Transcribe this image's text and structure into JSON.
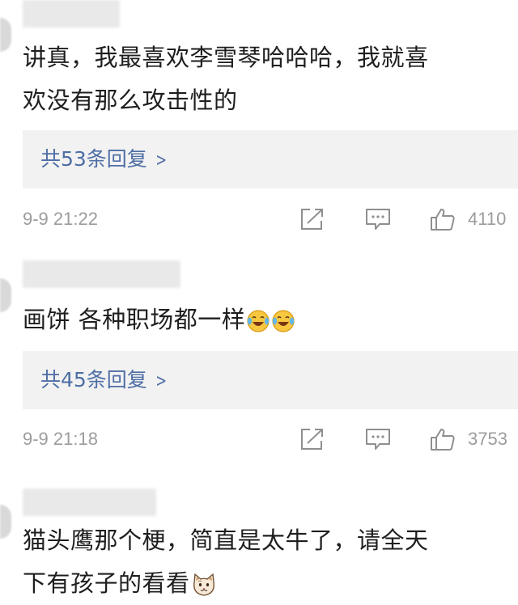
{
  "comments": [
    {
      "username": "",
      "text_lines": [
        "讲真，我最喜欢李雪琴哈哈哈，我就喜",
        "欢没有那么攻击性的"
      ],
      "emoji": [],
      "replies_label": "共53条回复",
      "timestamp": "9-9 21:22",
      "like_count": "4110",
      "icons": {
        "share": "share-icon",
        "reply": "comment-icon",
        "like": "thumbs-up-icon"
      }
    },
    {
      "username": "",
      "text_lines": [
        "画饼 各种职场都一样"
      ],
      "emoji": [
        "laugh-cry-emoji",
        "laugh-cry-emoji"
      ],
      "replies_label": "共45条回复",
      "timestamp": "9-9 21:18",
      "like_count": "3753",
      "icons": {
        "share": "share-icon",
        "reply": "comment-icon",
        "like": "thumbs-up-icon"
      }
    },
    {
      "username": "",
      "text_lines": [
        "猫头鹰那个梗，简直是太牛了，请全天",
        "下有孩子的看看"
      ],
      "emoji": [
        "cat-emoji"
      ],
      "icons": {}
    }
  ],
  "colors": {
    "link": "#4e6ea5",
    "meta_text": "#9c9c9c",
    "reply_box_bg": "#f2f2f2",
    "icon_stroke": "#8f8f8f"
  }
}
